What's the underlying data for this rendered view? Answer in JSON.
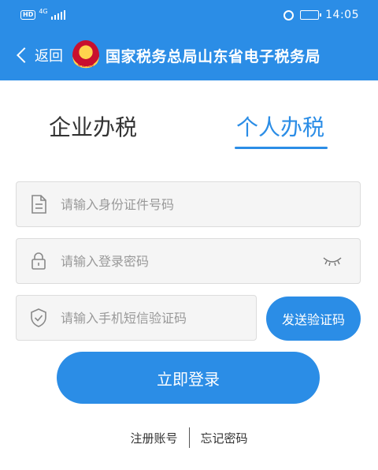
{
  "status_bar": {
    "hd": "HD",
    "network": "4G",
    "time": "14:05",
    "battery_level": 0.75
  },
  "nav": {
    "back_label": "返回",
    "title": "国家税务总局山东省电子税务局"
  },
  "tabs": [
    {
      "label": "企业办税",
      "active": false
    },
    {
      "label": "个人办税",
      "active": true
    }
  ],
  "form": {
    "id_placeholder": "请输入身份证件号码",
    "password_placeholder": "请输入登录密码",
    "sms_placeholder": "请输入手机短信验证码",
    "send_code_label": "发送验证码",
    "login_label": "立即登录"
  },
  "links": {
    "register": "注册账号",
    "forgot": "忘记密码"
  },
  "colors": {
    "primary": "#2b8de6",
    "field_bg": "#f5f5f5",
    "placeholder": "#999999"
  }
}
